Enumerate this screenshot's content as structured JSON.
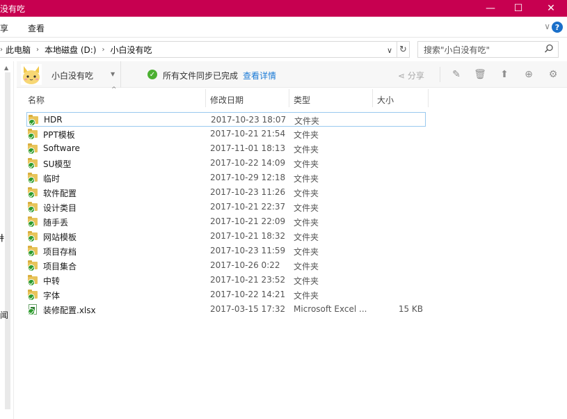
{
  "window": {
    "title": "没有吃",
    "minimize": "—",
    "maximize": "☐",
    "close": "✕"
  },
  "ribbon": {
    "tabs": [
      "享",
      "查看"
    ],
    "expand": "∨",
    "help": "?"
  },
  "address": {
    "crumbs": [
      "此电脑",
      "本地磁盘 (D:)",
      "小白没有吃"
    ],
    "search_placeholder": "搜索\"小白没有吃\""
  },
  "leftnav": {
    "fragments": [
      "ǂ",
      "闻"
    ]
  },
  "cloud": {
    "account_name": "小白没有吃",
    "sync_status": "所有文件同步已完成",
    "sync_link": "查看详情",
    "share_label": "分享"
  },
  "columns": {
    "name": "名称",
    "date": "修改日期",
    "type": "类型",
    "size": "大小"
  },
  "files": [
    {
      "name": "HDR",
      "date": "2017-10-23 18:07",
      "type": "文件夹",
      "size": "",
      "kind": "folder"
    },
    {
      "name": "PPT模板",
      "date": "2017-10-21 21:54",
      "type": "文件夹",
      "size": "",
      "kind": "folder"
    },
    {
      "name": "Software",
      "date": "2017-11-01 18:13",
      "type": "文件夹",
      "size": "",
      "kind": "folder"
    },
    {
      "name": "SU模型",
      "date": "2017-10-22 14:09",
      "type": "文件夹",
      "size": "",
      "kind": "folder"
    },
    {
      "name": "临时",
      "date": "2017-10-29 12:18",
      "type": "文件夹",
      "size": "",
      "kind": "folder"
    },
    {
      "name": "软件配置",
      "date": "2017-10-23 11:26",
      "type": "文件夹",
      "size": "",
      "kind": "folder"
    },
    {
      "name": "设计类目",
      "date": "2017-10-21 22:37",
      "type": "文件夹",
      "size": "",
      "kind": "folder"
    },
    {
      "name": "随手丢",
      "date": "2017-10-21 22:09",
      "type": "文件夹",
      "size": "",
      "kind": "folder"
    },
    {
      "name": "网站模板",
      "date": "2017-10-21 18:32",
      "type": "文件夹",
      "size": "",
      "kind": "folder"
    },
    {
      "name": "项目存档",
      "date": "2017-10-23 11:59",
      "type": "文件夹",
      "size": "",
      "kind": "folder"
    },
    {
      "name": "项目集合",
      "date": "2017-10-26 0:22",
      "type": "文件夹",
      "size": "",
      "kind": "folder"
    },
    {
      "name": "中转",
      "date": "2017-10-21 23:52",
      "type": "文件夹",
      "size": "",
      "kind": "folder"
    },
    {
      "name": "字体",
      "date": "2017-10-22 14:21",
      "type": "文件夹",
      "size": "",
      "kind": "folder"
    },
    {
      "name": "装修配置.xlsx",
      "date": "2017-03-15 17:32",
      "type": "Microsoft Excel ...",
      "size": "15 KB",
      "kind": "excel"
    }
  ],
  "colors": {
    "titlebar": "#c70050",
    "link": "#1a7ad6",
    "sync_ok": "#4cb032",
    "selection_border": "#99c9ef"
  }
}
